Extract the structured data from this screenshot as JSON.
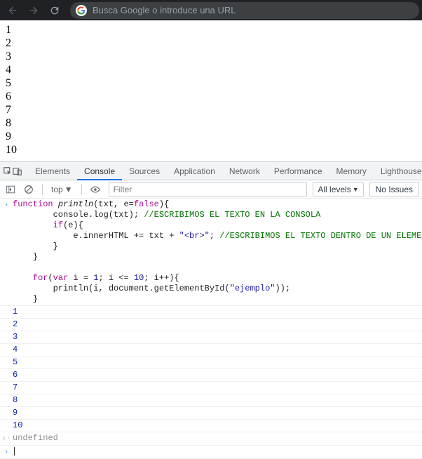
{
  "browser": {
    "omnibox_placeholder": "Busca Google o introduce una URL",
    "g_label": "G"
  },
  "page": {
    "lines": [
      "1",
      "2",
      "3",
      "4",
      "5",
      "6",
      "7",
      "8",
      "9",
      "10"
    ]
  },
  "devtools": {
    "tabs": [
      "Elements",
      "Console",
      "Sources",
      "Application",
      "Network",
      "Performance",
      "Memory",
      "Lighthouse"
    ],
    "active_tab": "Console",
    "toolbar": {
      "context": "top",
      "filter_placeholder": "Filter",
      "levels": "All levels",
      "issues": "No Issues"
    },
    "code": {
      "l1_kw1": "function ",
      "l1_fn": "println",
      "l1_p": "(txt, e=",
      "l1_kw2": "false",
      "l1_close": "){",
      "l2a": "        console.log(txt); ",
      "l2c": "//ESCRIBIMOS EL TEXTO EN LA CONSOLA",
      "l3_kw": "        if",
      "l3_t": "(e){",
      "l4a": "            e.innerHTML += txt + ",
      "l4s": "\"<br>\"",
      "l4b": "; ",
      "l4c": "//ESCRIBIMOS EL TEXTO DENTRO DE UN ELEMENTO HTML",
      "l5": "        }",
      "l6": "    }",
      "l7": "",
      "l8_kw1": "    for",
      "l8_a": "(",
      "l8_kw2": "var",
      "l8_b": " i = ",
      "l8_n1": "1",
      "l8_c": "; i <= ",
      "l8_n2": "10",
      "l8_d": "; i++){",
      "l9a": "        println(i, document.getElementById(",
      "l9s": "\"ejemplo\"",
      "l9b": "));",
      "l10": "    }"
    },
    "outputs": [
      "1",
      "2",
      "3",
      "4",
      "5",
      "6",
      "7",
      "8",
      "9",
      "10"
    ],
    "result": "undefined"
  }
}
